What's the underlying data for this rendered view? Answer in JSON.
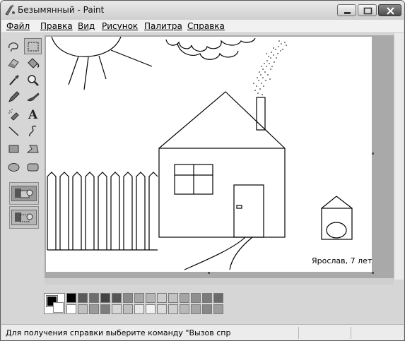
{
  "window": {
    "title": "Безымянный - Paint"
  },
  "menu": {
    "items": [
      "Файл",
      "Правка",
      "Вид",
      "Рисунок",
      "Палитра",
      "Справка"
    ]
  },
  "toolbox": {
    "tools": [
      "free-select",
      "rect-select",
      "eraser",
      "fill",
      "color-picker",
      "magnifier",
      "pencil",
      "brush",
      "airbrush",
      "text",
      "line",
      "curve",
      "rectangle",
      "polygon",
      "ellipse",
      "rounded-rectangle"
    ],
    "active_tool": "rect-select"
  },
  "canvas": {
    "signature": "Ярослав, 7 лет"
  },
  "palette": {
    "foreground": "#000000",
    "background": "#ffffff",
    "row1": [
      "#000000",
      "#5a5a5a",
      "#6e6e6e",
      "#444444",
      "#555555",
      "#8a8a8a",
      "#a8a8a8",
      "#b5b5b5",
      "#cdcdcd",
      "#c2c2c2",
      "#a3a3a3",
      "#8f8f8f",
      "#7b7b7b",
      "#6a6a6a"
    ],
    "row2": [
      "#ffffff",
      "#c0c0c0",
      "#9a9a9a",
      "#7d7d7d",
      "#d6d6d6",
      "#bfbfbf",
      "#e8e8e8",
      "#f2f2f2",
      "#dcdcdc",
      "#d0d0d0",
      "#b8b8b8",
      "#a6a6a6",
      "#888888",
      "#9d9d9d"
    ]
  },
  "status": {
    "help_text": "Для получения справки выберите команду \"Вызов спр"
  }
}
